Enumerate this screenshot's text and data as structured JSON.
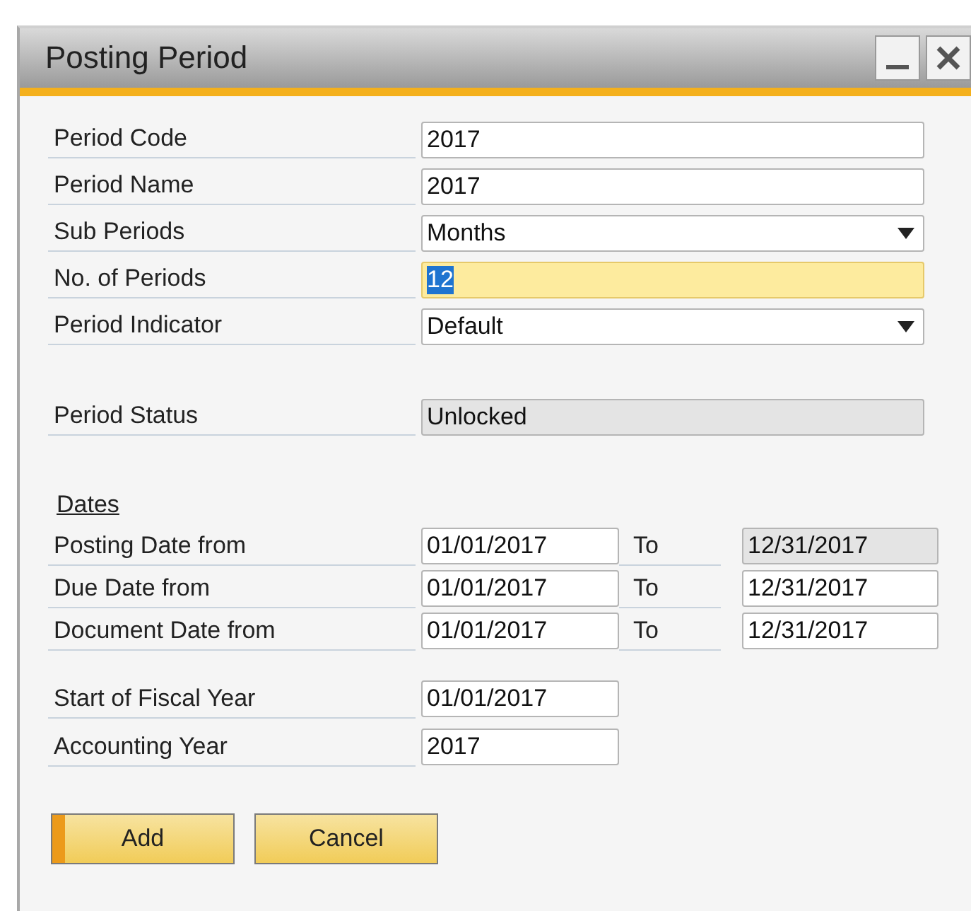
{
  "window": {
    "title": "Posting Period"
  },
  "general_fields": [
    {
      "label": "Period Code",
      "kind": "text",
      "value": "2017",
      "focused": false,
      "disabled": false
    },
    {
      "label": "Period Name",
      "kind": "text",
      "value": "2017",
      "focused": false,
      "disabled": false
    },
    {
      "label": "Sub Periods",
      "kind": "dropdown",
      "value": "Months",
      "focused": false,
      "disabled": false
    },
    {
      "label": "No. of Periods",
      "kind": "text",
      "value": "12",
      "focused": true,
      "disabled": false
    },
    {
      "label": "Period Indicator",
      "kind": "dropdown",
      "value": "Default",
      "focused": false,
      "disabled": false
    }
  ],
  "status_field": {
    "label": "Period Status",
    "value": "Unlocked",
    "focused": false,
    "disabled": true
  },
  "dates": {
    "heading": "Dates",
    "rows": [
      {
        "label": "Posting Date from",
        "from": {
          "value": "01/01/2017",
          "disabled": false
        },
        "to_label": "To",
        "to": {
          "value": "12/31/2017",
          "disabled": true
        }
      },
      {
        "label": "Due Date from",
        "from": {
          "value": "01/01/2017",
          "disabled": false
        },
        "to_label": "To",
        "to": {
          "value": "12/31/2017",
          "disabled": false
        }
      },
      {
        "label": "Document Date from",
        "from": {
          "value": "01/01/2017",
          "disabled": false
        },
        "to_label": "To",
        "to": {
          "value": "12/31/2017",
          "disabled": false
        }
      }
    ]
  },
  "year_fields": [
    {
      "label": "Start of Fiscal Year",
      "value": "01/01/2017",
      "focused": false,
      "disabled": false
    },
    {
      "label": "Accounting Year",
      "value": "2017",
      "focused": false,
      "disabled": false
    }
  ],
  "buttons": [
    {
      "label": "Add",
      "default": true
    },
    {
      "label": "Cancel",
      "default": false
    }
  ]
}
